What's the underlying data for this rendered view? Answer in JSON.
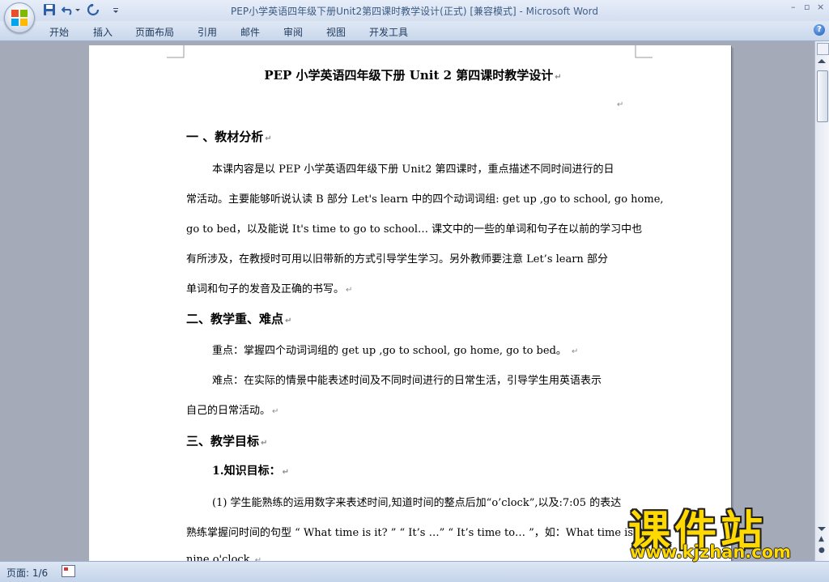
{
  "window": {
    "title_doc": "PEP小学英语四年级下册Unit2第四课时教学设计(正式) [兼容模式]",
    "title_sep": " - ",
    "title_app": "Microsoft Word",
    "minimize": "–",
    "restore": "▫",
    "close": "×"
  },
  "ribbon": {
    "tabs": [
      "开始",
      "插入",
      "页面布局",
      "引用",
      "邮件",
      "审阅",
      "视图",
      "开发工具"
    ],
    "help": "?"
  },
  "document": {
    "title": "PEP 小学英语四年级下册 Unit 2 第四课时教学设计",
    "sections": {
      "s1_heading": "一 、教材分析",
      "s1_p1": "本课内容是以 PEP 小学英语四年级下册 Unit2 第四课时，重点描述不同时间进行的日",
      "s1_p2": "常活动。主要能够听说认读 B 部分 Let's learn  中的四个动词词组: get up ,go to school, go home,",
      "s1_p3": "go to bed，以及能说 It's time to go to school…  课文中的一些的单词和句子在以前的学习中也",
      "s1_p4": "有所涉及，在教授时可用以旧带新的方式引导学生学习。另外教师要注意 Let’s learn  部分",
      "s1_p5": "单词和句子的发音及正确的书写。",
      "s2_heading": "二、教学重、难点",
      "s2_p1": "重点：掌握四个动词词组的 get up ,go to school, go home, go to bed。 ",
      "s2_p2": "难点：在实际的情景中能表述时间及不同时间进行的日常生活，引导学生用英语表示",
      "s2_p3": "自己的日常活动。",
      "s3_heading": "三、教学目标",
      "s3_sub": "1.知识目标：",
      "s3_p1": "(1)  学生能熟练的运用数字来表述时间,知道时间的整点后加“o’clock”,以及:7:05 的表达",
      "s3_p2": "熟练掌握问时间的句型 “ What time is it? ” “ It’s …” “ It’s time to… ”，如：What time is it? It's",
      "s3_p3": "nine o'clock."
    },
    "para_mark": "↵"
  },
  "statusbar": {
    "page_label": "页面: 1/6"
  },
  "watermark": {
    "brand": "课件站",
    "url": "www.kjzhan.com"
  },
  "colors": {
    "title_text": "#3b5a82",
    "workspace": "#a4aab7",
    "watermark_fill": "#ffd900"
  }
}
